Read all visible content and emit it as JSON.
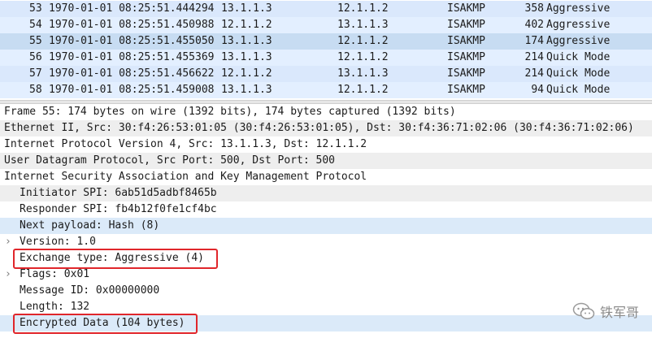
{
  "packets": [
    {
      "no": "53",
      "time": "1970-01-01 08:25:51.444294",
      "src": "13.1.1.3",
      "dst": "12.1.1.2",
      "proto": "ISAKMP",
      "len": "358",
      "info": "Aggressive"
    },
    {
      "no": "54",
      "time": "1970-01-01 08:25:51.450988",
      "src": "12.1.1.2",
      "dst": "13.1.1.3",
      "proto": "ISAKMP",
      "len": "402",
      "info": "Aggressive"
    },
    {
      "no": "55",
      "time": "1970-01-01 08:25:51.455050",
      "src": "13.1.1.3",
      "dst": "12.1.1.2",
      "proto": "ISAKMP",
      "len": "174",
      "info": "Aggressive"
    },
    {
      "no": "56",
      "time": "1970-01-01 08:25:51.455369",
      "src": "13.1.1.3",
      "dst": "12.1.1.2",
      "proto": "ISAKMP",
      "len": "214",
      "info": "Quick Mode"
    },
    {
      "no": "57",
      "time": "1970-01-01 08:25:51.456622",
      "src": "12.1.1.2",
      "dst": "13.1.1.3",
      "proto": "ISAKMP",
      "len": "214",
      "info": "Quick Mode"
    },
    {
      "no": "58",
      "time": "1970-01-01 08:25:51.459008",
      "src": "13.1.1.3",
      "dst": "12.1.1.2",
      "proto": "ISAKMP",
      "len": "94",
      "info": "Quick Mode"
    }
  ],
  "details": {
    "frame": "Frame 55: 174 bytes on wire (1392 bits), 174 bytes captured (1392 bits)",
    "ethernet": "Ethernet II, Src: 30:f4:26:53:01:05 (30:f4:26:53:01:05), Dst: 30:f4:36:71:02:06 (30:f4:36:71:02:06)",
    "ip": "Internet Protocol Version 4, Src: 13.1.1.3, Dst: 12.1.1.2",
    "udp": "User Datagram Protocol, Src Port: 500, Dst Port: 500",
    "isakmp": "Internet Security Association and Key Management Protocol",
    "initiator_spi": "Initiator SPI: 6ab51d5adbf8465b",
    "responder_spi": "Responder SPI: fb4b12f0fe1cf4bc",
    "next_payload": "Next payload: Hash (8)",
    "version": "Version: 1.0",
    "exchange_type": "Exchange type: Aggressive (4)",
    "flags": "Flags: 0x01",
    "message_id": "Message ID: 0x00000000",
    "length": "Length: 132",
    "encrypted_data": "Encrypted Data (104 bytes)"
  },
  "watermark": {
    "text": "铁军哥"
  }
}
